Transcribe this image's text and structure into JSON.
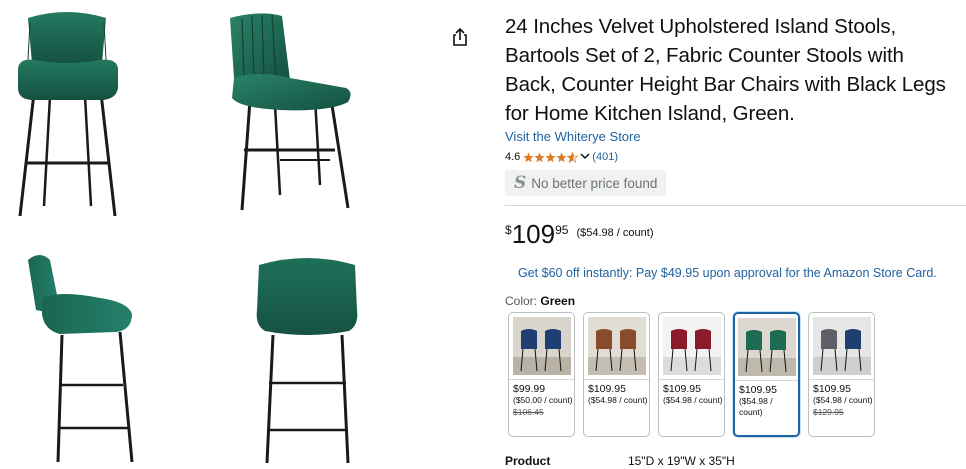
{
  "product": {
    "title": "24 Inches Velvet Upholstered Island Stools, Bartools Set of 2, Fabric Counter Stools with Back, Counter Height Bar Chairs with Black Legs for Home Kitchen Island, Green.",
    "store_link": "Visit the Whiterye Store",
    "rating": "4.6",
    "rating_value": 4.6,
    "rating_count": "(401)",
    "no_better_price": "No better price found",
    "no_better_price_logo": "S"
  },
  "price": {
    "currency": "$",
    "whole": "109",
    "fraction": "95",
    "per_unit": "($54.98 / count)"
  },
  "promo": "Get $60 off instantly: Pay $49.95 upon approval for the Amazon Store Card.",
  "color": {
    "label": "Color:",
    "selected": "Green"
  },
  "swatches": [
    {
      "name": "Navy",
      "price": "$99.99",
      "unit": "($50.00 / count)",
      "list_price": "$106.45",
      "color": "#1f3f73"
    },
    {
      "name": "Brown",
      "price": "$109.95",
      "unit": "($54.98 / count)",
      "list_price": "",
      "color": "#8a4a2c"
    },
    {
      "name": "Red",
      "price": "$109.95",
      "unit": "($54.98 / count)",
      "list_price": "",
      "color": "#8b1a2a"
    },
    {
      "name": "Green",
      "price": "$109.95",
      "unit": "($54.98 / count)",
      "list_price": "",
      "color": "#1e6b53"
    },
    {
      "name": "Grey",
      "price": "$109.95",
      "unit": "($54.98 / count)",
      "list_price": "$129.95",
      "color": "#5d6066"
    }
  ],
  "spec": {
    "key": "Product",
    "value": "15\"D x 19\"W x 35\"H"
  },
  "colors": {
    "velvet_green": "#1c6b55",
    "link_blue": "#2162a1",
    "star_orange": "#de7921"
  },
  "icons": {
    "share": "share-icon",
    "chevron": "chevron-down-icon"
  }
}
